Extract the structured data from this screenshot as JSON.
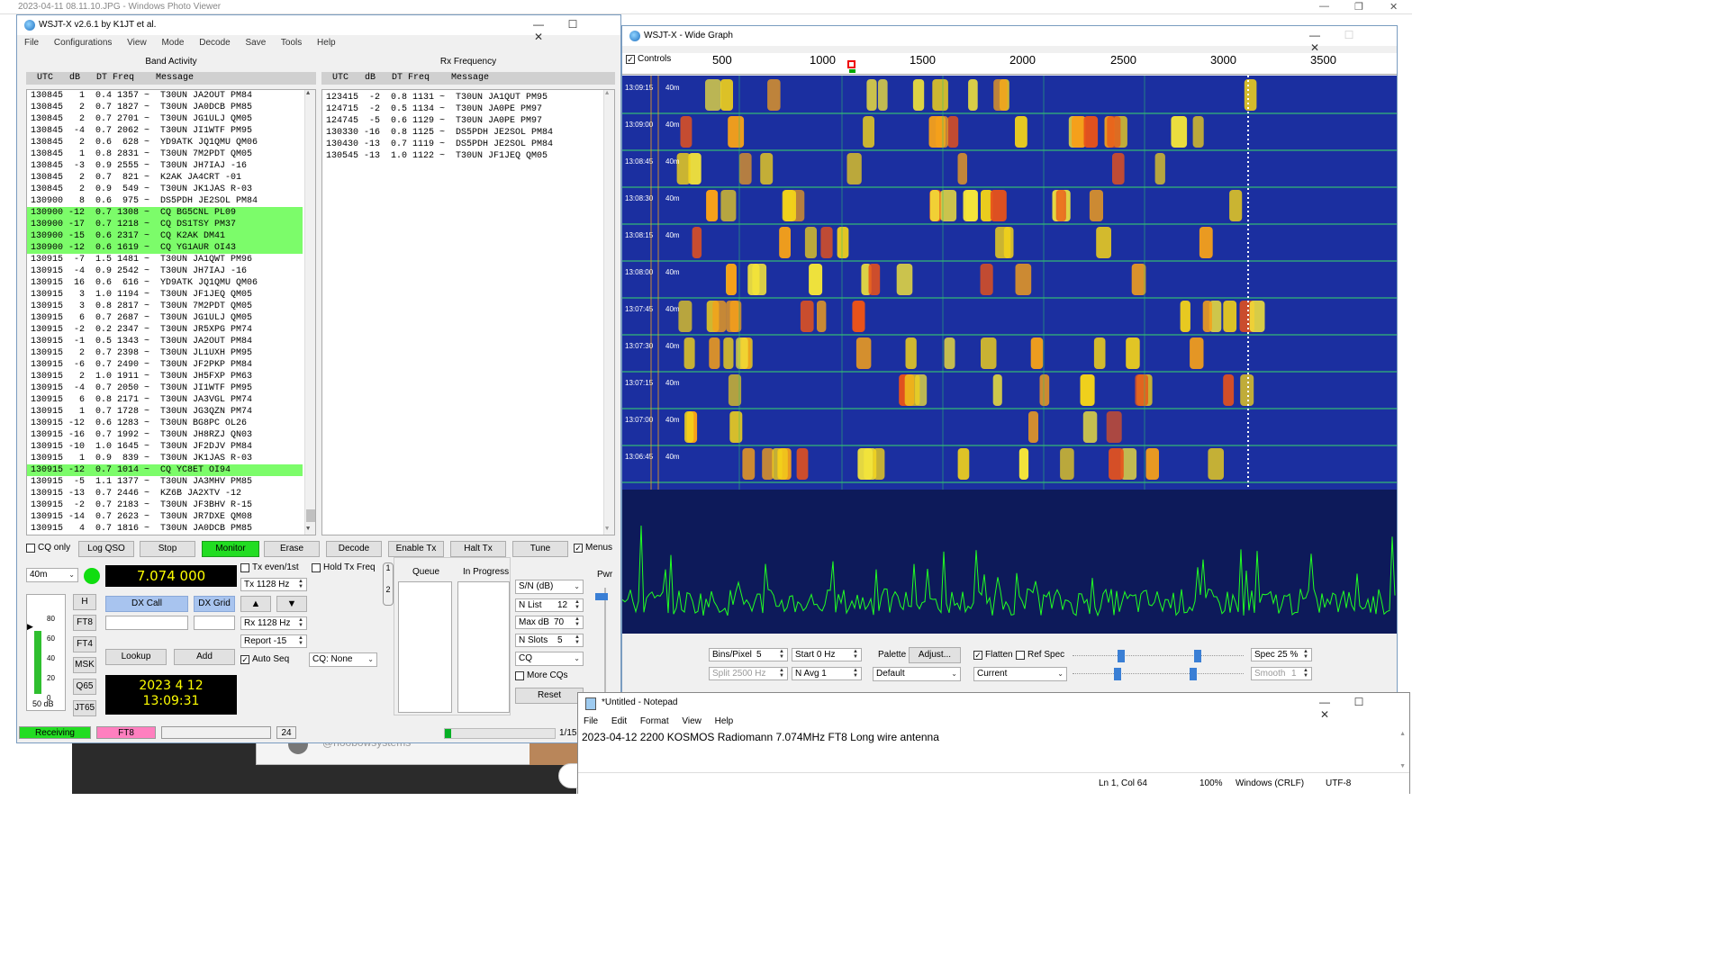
{
  "photo_viewer": {
    "title": "2023-04-11 08.11.10.JPG - Windows Photo Viewer",
    "card_text": "@hoobowsystems"
  },
  "wsjtx": {
    "title": "WSJT-X   v2.6.1   by K1JT et al.",
    "menu": [
      "File",
      "Configurations",
      "View",
      "Mode",
      "Decode",
      "Save",
      "Tools",
      "Help"
    ],
    "band_activity": {
      "label": "Band Activity",
      "header": "  UTC   dB   DT Freq    Message",
      "rows": [
        {
          "text": "130845   1  0.4 1357 ~  T30UN JA2OUT PM84",
          "cq": false
        },
        {
          "text": "130845   2  0.7 1827 ~  T30UN JA0DCB PM85",
          "cq": false
        },
        {
          "text": "130845   2  0.7 2701 ~  T30UN JG1ULJ QM05",
          "cq": false
        },
        {
          "text": "130845  -4  0.7 2062 ~  T30UN JI1WTF PM95",
          "cq": false
        },
        {
          "text": "130845   2  0.6  628 ~  YD9ATK JQ1QMU QM06",
          "cq": false
        },
        {
          "text": "130845   1  0.8 2831 ~  T30UN 7M2PDT QM05",
          "cq": false
        },
        {
          "text": "130845  -3  0.9 2555 ~  T30UN JH7IAJ -16",
          "cq": false
        },
        {
          "text": "130845   2  0.7  821 ~  K2AK JA4CRT -01",
          "cq": false
        },
        {
          "text": "130845   2  0.9  549 ~  T30UN JK1JAS R-03",
          "cq": false
        },
        {
          "text": "130900   8  0.6  975 ~  DS5PDH JE2SOL PM84",
          "cq": false
        },
        {
          "text": "130900 -12  0.7 1308 ~  CQ BG5CNL PL09",
          "cq": true
        },
        {
          "text": "130900 -17  0.7 1218 ~  CQ DS1TSY PM37",
          "cq": true
        },
        {
          "text": "130900 -15  0.6 2317 ~  CQ K2AK DM41",
          "cq": true
        },
        {
          "text": "130900 -12  0.6 1619 ~  CQ YG1AUR OI43",
          "cq": true
        },
        {
          "text": "130915  -7  1.5 1481 ~  T30UN JA1QWT PM96",
          "cq": false
        },
        {
          "text": "130915  -4  0.9 2542 ~  T30UN JH7IAJ -16",
          "cq": false
        },
        {
          "text": "130915  16  0.6  616 ~  YD9ATK JQ1QMU QM06",
          "cq": false
        },
        {
          "text": "130915   3  1.0 1194 ~  T30UN JF1JEQ QM05",
          "cq": false
        },
        {
          "text": "130915   3  0.8 2817 ~  T30UN 7M2PDT QM05",
          "cq": false
        },
        {
          "text": "130915   6  0.7 2687 ~  T30UN JG1ULJ QM05",
          "cq": false
        },
        {
          "text": "130915  -2  0.2 2347 ~  T30UN JR5XPG PM74",
          "cq": false
        },
        {
          "text": "130915  -1  0.5 1343 ~  T30UN JA2OUT PM84",
          "cq": false
        },
        {
          "text": "130915   2  0.7 2398 ~  T30UN JL1UXH PM95",
          "cq": false
        },
        {
          "text": "130915  -6  0.7 2490 ~  T30UN JF2PKP PM84",
          "cq": false
        },
        {
          "text": "130915   2  1.0 1911 ~  T30UN JH5FXP PM63",
          "cq": false
        },
        {
          "text": "130915  -4  0.7 2050 ~  T30UN JI1WTF PM95",
          "cq": false
        },
        {
          "text": "130915   6  0.8 2171 ~  T30UN JA3VGL PM74",
          "cq": false
        },
        {
          "text": "130915   1  0.7 1728 ~  T30UN JG3QZN PM74",
          "cq": false
        },
        {
          "text": "130915 -12  0.6 1283 ~  T30UN BG8PC OL26",
          "cq": false
        },
        {
          "text": "130915 -16  0.7 1992 ~  T30UN JH8RZJ QN03",
          "cq": false
        },
        {
          "text": "130915 -10  1.0 1645 ~  T30UN JF2DJV PM84",
          "cq": false
        },
        {
          "text": "130915   1  0.9  839 ~  T30UN JK1JAS R-03",
          "cq": false
        },
        {
          "text": "130915 -12  0.7 1014 ~  CQ YC8ET OI94",
          "cq": true
        },
        {
          "text": "130915  -5  1.1 1377 ~  T30UN JA3MHV PM85",
          "cq": false
        },
        {
          "text": "130915 -13  0.7 2446 ~  KZ6B JA2XTV -12",
          "cq": false
        },
        {
          "text": "130915  -2  0.7 2183 ~  T30UN JF3BHV R-15",
          "cq": false
        },
        {
          "text": "130915 -14  0.7 2623 ~  T30UN JR7DXE QM08",
          "cq": false
        },
        {
          "text": "130915   4  0.7 1816 ~  T30UN JA0DCB PM85",
          "cq": false
        }
      ]
    },
    "rx_frequency": {
      "label": "Rx Frequency",
      "header": "  UTC   dB   DT Freq    Message",
      "rows": [
        "123415  -2  0.8 1131 ~  T30UN JA1QUT PM95",
        "124715  -2  0.5 1134 ~  T30UN JA0PE PM97",
        "124745  -5  0.6 1129 ~  T30UN JA0PE PM97",
        "130330 -16  0.8 1125 ~  DS5PDH JE2SOL PM84",
        "130430 -13  0.7 1119 ~  DS5PDH JE2SOL PM84",
        "130545 -13  1.0 1122 ~  T30UN JF1JEQ QM05"
      ]
    },
    "buttons": {
      "cq_only": "CQ only",
      "log_qso": "Log QSO",
      "stop": "Stop",
      "monitor": "Monitor",
      "erase": "Erase",
      "decode": "Decode",
      "enable_tx": "Enable Tx",
      "halt_tx": "Halt Tx",
      "tune": "Tune",
      "menus": "Menus"
    },
    "band": "40m",
    "frequency": "7.074 000",
    "tx_even": "Tx even/1st",
    "hold_tx": "Hold Tx Freq",
    "tx_freq": "Tx  1128  Hz",
    "rx_freq": "Rx  1128  Hz",
    "report": "Report -15",
    "auto_seq": "Auto Seq",
    "cq_none": "CQ: None",
    "dx_call_btn": "DX Call",
    "dx_grid_btn": "DX Grid",
    "lookup": "Lookup",
    "add": "Add",
    "date": "2023 4 12",
    "time": "13:09:31",
    "modes": [
      "H",
      "FT8",
      "FT4",
      "MSK",
      "Q65",
      "JT65"
    ],
    "meter_ticks": [
      "80",
      "60",
      "40",
      "20",
      "0"
    ],
    "meter_label": "50 dB",
    "queue": "Queue",
    "in_progress": "In Progress",
    "tab_labels": [
      "1",
      "2"
    ],
    "pwr": "Pwr",
    "sn": "S/N (dB)",
    "n_list": "N List",
    "n_list_val": "12",
    "max_db": "Max dB",
    "max_db_val": "70",
    "n_slots": "N Slots",
    "n_slots_val": "5",
    "cq_combo": "CQ",
    "more_cqs": "More CQs",
    "reset": "Reset",
    "status": {
      "receiving": "Receiving",
      "mode": "FT8",
      "counter": "24",
      "progress_frac": 0.06,
      "slot": "1/15"
    }
  },
  "wide_graph": {
    "title": "WSJT-X - Wide Graph",
    "controls": "Controls",
    "scale": [
      "500",
      "1000",
      "1500",
      "2000",
      "2500",
      "3000",
      "3500"
    ],
    "time_labels": [
      "13:09:15",
      "13:09:00",
      "13:08:45",
      "13:08:30",
      "13:08:15",
      "13:08:00",
      "13:07:45",
      "13:07:30",
      "13:07:15",
      "13:07:00",
      "13:06:45"
    ],
    "band_label": "40m",
    "bins_pixel": "Bins/Pixel",
    "bins_val": "5",
    "start": "Start  0 Hz",
    "palette": "Palette",
    "adjust": "Adjust...",
    "flatten": "Flatten",
    "ref_spec": "Ref Spec",
    "spec": "Spec  25 %",
    "split": "Split  2500  Hz",
    "n_avg": "N Avg  1",
    "default": "Default",
    "current": "Current",
    "smooth": "Smooth",
    "smooth_val": "1"
  },
  "notepad": {
    "title": "*Untitled - Notepad",
    "menu": [
      "File",
      "Edit",
      "Format",
      "View",
      "Help"
    ],
    "text": "2023-04-12 2200 KOSMOS Radiomann 7.074MHz FT8 Long wire antenna",
    "position": "Ln 1, Col 64",
    "zoom": "100%",
    "line_ending": "Windows (CRLF)",
    "encoding": "UTF-8"
  },
  "colors": {
    "cq_highlight": "#7cfc6a",
    "monitor_green": "#22dd22",
    "waterfall_blue": "#1b2fa0",
    "spectrum_green": "#22ff22",
    "lcd_yellow": "#ffff00"
  }
}
